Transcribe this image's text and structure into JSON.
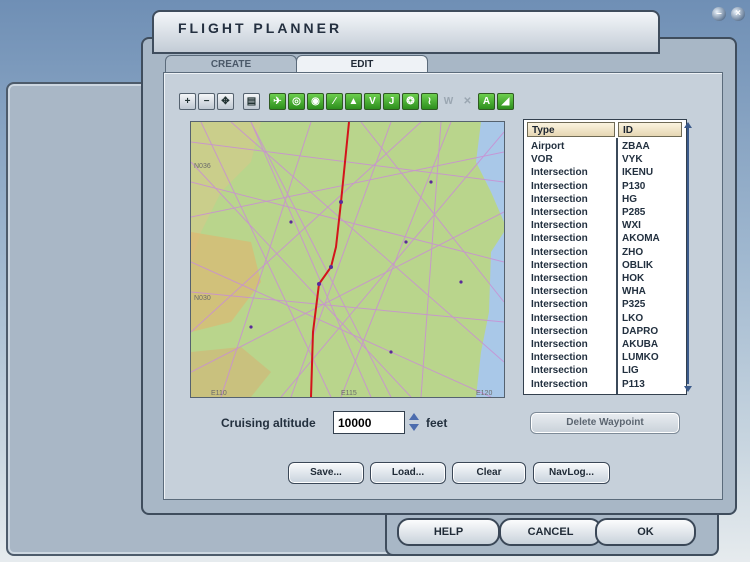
{
  "window": {
    "title": "FLIGHT PLANNER"
  },
  "tabs": [
    {
      "label": "CREATE"
    },
    {
      "label": "EDIT"
    }
  ],
  "waypoints": {
    "columns": {
      "type": "Type",
      "id": "ID"
    },
    "rows": [
      {
        "type": "Airport",
        "id": "ZBAA"
      },
      {
        "type": "VOR",
        "id": "VYK"
      },
      {
        "type": "Intersection",
        "id": "IKENU"
      },
      {
        "type": "Intersection",
        "id": "P130"
      },
      {
        "type": "Intersection",
        "id": "HG"
      },
      {
        "type": "Intersection",
        "id": "P285"
      },
      {
        "type": "Intersection",
        "id": "WXI"
      },
      {
        "type": "Intersection",
        "id": "AKOMA"
      },
      {
        "type": "Intersection",
        "id": "ZHO"
      },
      {
        "type": "Intersection",
        "id": "OBLIK"
      },
      {
        "type": "Intersection",
        "id": "HOK"
      },
      {
        "type": "Intersection",
        "id": "WHA"
      },
      {
        "type": "Intersection",
        "id": "P325"
      },
      {
        "type": "Intersection",
        "id": "LKO"
      },
      {
        "type": "Intersection",
        "id": "DAPRO"
      },
      {
        "type": "Intersection",
        "id": "AKUBA"
      },
      {
        "type": "Intersection",
        "id": "LUMKO"
      },
      {
        "type": "Intersection",
        "id": "LIG"
      },
      {
        "type": "Intersection",
        "id": "P113"
      }
    ]
  },
  "altitude": {
    "label": "Cruising altitude",
    "value": "10000",
    "unit": "feet"
  },
  "buttons": {
    "delete_waypoint": "Delete Waypoint",
    "save": "Save...",
    "load": "Load...",
    "clear": "Clear",
    "navlog": "NavLog..."
  },
  "footer": {
    "help": "HELP",
    "cancel": "CANCEL",
    "ok": "OK"
  },
  "map": {
    "labels": [
      "N036",
      "N030",
      "E110",
      "E115",
      "E120"
    ]
  },
  "colors": {
    "route": "#d3141a",
    "airways": "#c98fd3",
    "land": "#b9d58c",
    "water": "#a9c8e8"
  }
}
